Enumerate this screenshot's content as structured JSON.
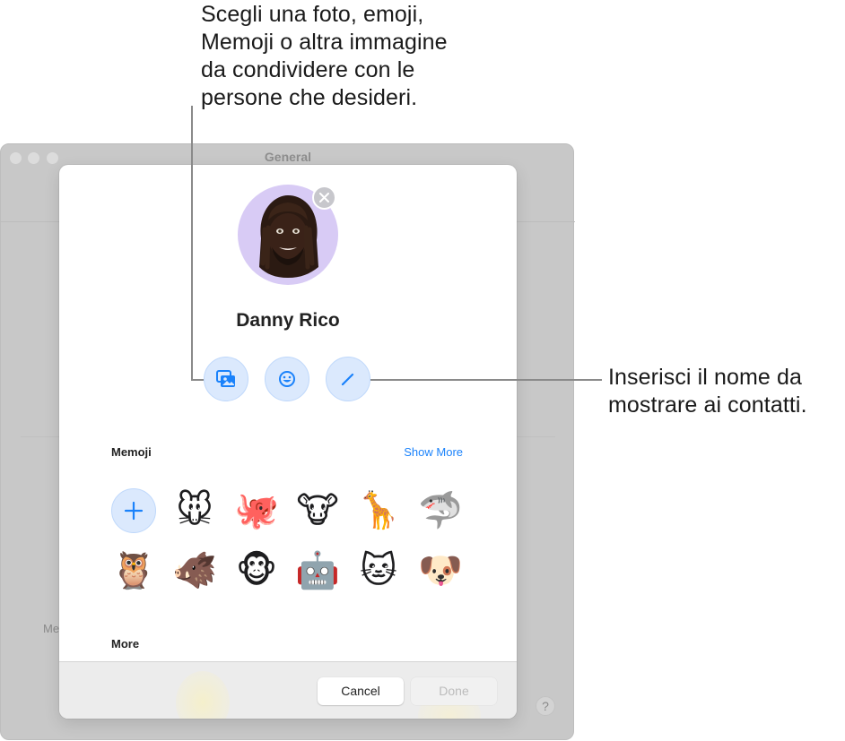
{
  "callouts": {
    "top": "Scegli una foto, emoji,\nMemoji o altra immagine\nda condividere con le\npersone che desideri.",
    "right": "Inserisci il nome da\nmostrare ai contatti."
  },
  "window": {
    "title": "General",
    "side_label": "Me",
    "help_label": "?"
  },
  "sheet": {
    "user_name": "Danny Rico",
    "avatar": {
      "icon": "memoji-avatar",
      "background": "#d8cbf5"
    },
    "actions": [
      {
        "name": "photo-button",
        "icon": "photos-icon"
      },
      {
        "name": "emoji-button",
        "icon": "smiley-icon"
      },
      {
        "name": "edit-name-button",
        "icon": "pencil-icon"
      }
    ],
    "memoji_section": {
      "title": "Memoji",
      "show_more": "Show More",
      "add_label": "+",
      "items": [
        {
          "name": "mouse",
          "glyph": "🐭"
        },
        {
          "name": "octopus",
          "glyph": "🐙"
        },
        {
          "name": "cow",
          "glyph": "🐮"
        },
        {
          "name": "giraffe",
          "glyph": "🦒"
        },
        {
          "name": "shark",
          "glyph": "🦈"
        },
        {
          "name": "owl",
          "glyph": "🦉"
        },
        {
          "name": "boar",
          "glyph": "🐗"
        },
        {
          "name": "monkey",
          "glyph": "🐵"
        },
        {
          "name": "robot",
          "glyph": "🤖"
        },
        {
          "name": "cat",
          "glyph": "🐱"
        },
        {
          "name": "dog",
          "glyph": "🐶"
        }
      ]
    },
    "more_section": {
      "title": "More"
    },
    "footer": {
      "cancel": "Cancel",
      "done": "Done"
    }
  },
  "colors": {
    "accent": "#1a82fb",
    "button_tint": "#dbe9fd",
    "window_bg": "#c8c8c8"
  }
}
